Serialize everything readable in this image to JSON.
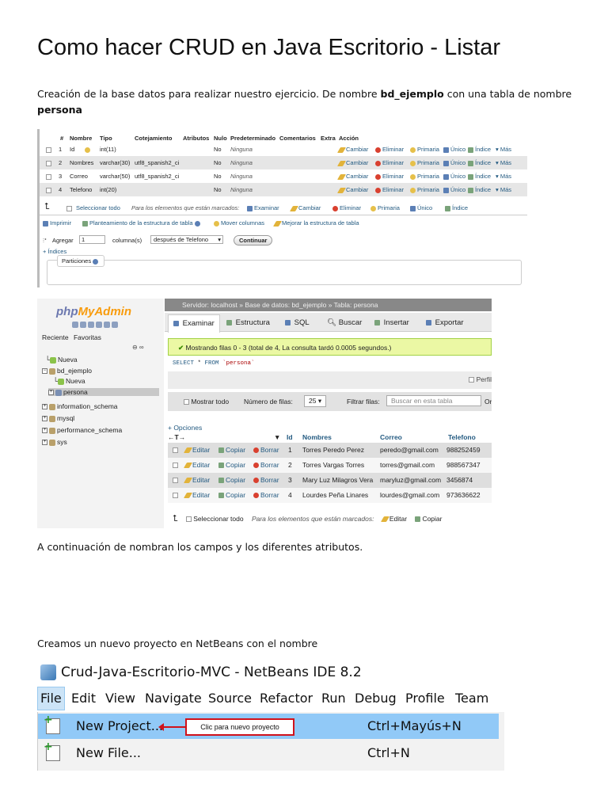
{
  "title": "Como hacer CRUD en Java Escritorio - Listar",
  "intro": {
    "before": "Creación de la base datos para realizar nuestro ejercicio. De nombre ",
    "db_name": "bd_ejemplo",
    "middle": " con una tabla de nombre ",
    "table_name": "persona"
  },
  "structure": {
    "headers": [
      "#",
      "Nombre",
      "Tipo",
      "Cotejamiento",
      "Atributos",
      "Nulo",
      "Predeterminado",
      "Comentarios",
      "Extra",
      "Acción"
    ],
    "rows": [
      {
        "num": "1",
        "name": "Id",
        "type": "int(11)",
        "coll": "",
        "null": "No",
        "default": "Ninguna"
      },
      {
        "num": "2",
        "name": "Nombres",
        "type": "varchar(30)",
        "coll": "utf8_spanish2_ci",
        "null": "No",
        "default": "Ninguna"
      },
      {
        "num": "3",
        "name": "Correo",
        "type": "varchar(50)",
        "coll": "utf8_spanish2_ci",
        "null": "No",
        "default": "Ninguna"
      },
      {
        "num": "4",
        "name": "Telefono",
        "type": "int(20)",
        "coll": "",
        "null": "No",
        "default": "Ninguna"
      }
    ],
    "actions": {
      "change": "Cambiar",
      "delete": "Eliminar",
      "primary": "Primaria",
      "unique": "Único",
      "index": "Índice",
      "more": "Más"
    },
    "select_all": "Seleccionar todo",
    "for_marked": "Para los elementos que están marcados:",
    "bulk": {
      "browse": "Examinar",
      "change": "Cambiar",
      "delete": "Eliminar",
      "primary": "Primaria",
      "unique": "Único",
      "index": "Índice"
    },
    "tools": {
      "print": "Imprimir",
      "plan": "Planteamiento de la estructura de tabla",
      "move": "Mover columnas",
      "improve": "Mejorar la estructura de tabla"
    },
    "add_label": "Agregar",
    "add_value": "1",
    "columns_label": "columna(s)",
    "after_value": "después de Telefono",
    "continue": "Continuar",
    "indexes": "+ Índices",
    "partitions": "Particiones"
  },
  "browse": {
    "logo": {
      "php": "php",
      "my": "My",
      "admin": "Admin"
    },
    "left_tabs": [
      "Reciente",
      "Favoritas"
    ],
    "tree": [
      {
        "label": "Nueva"
      },
      {
        "label": "bd_ejemplo"
      },
      {
        "label": "Nueva"
      },
      {
        "label": "persona"
      },
      {
        "label": "information_schema"
      },
      {
        "label": "mysql"
      },
      {
        "label": "performance_schema"
      },
      {
        "label": "sys"
      }
    ],
    "breadcrumb": "Servidor: localhost » Base de datos: bd_ejemplo » Tabla: persona",
    "tabs": [
      "Examinar",
      "Estructura",
      "SQL",
      "Buscar",
      "Insertar",
      "Exportar"
    ],
    "success": "Mostrando filas 0 - 3 (total de 4, La consulta tardó 0.0005 segundos.)",
    "sql": {
      "kw1": "SELECT",
      "rest": " * ",
      "kw2": "FROM",
      "str": " `persona`"
    },
    "profile": "Perfil",
    "nav": {
      "show_all": "Mostrar todo",
      "rows_label": "Número de filas:",
      "rows_value": "25",
      "filter_label": "Filtrar filas:",
      "filter_placeholder": "Buscar en esta tabla",
      "order": "Or"
    },
    "options": "+ Opciones",
    "columns": [
      "Id",
      "Nombres",
      "Correo",
      "Telefono"
    ],
    "row_actions": {
      "edit": "Editar",
      "copy": "Copiar",
      "delete": "Borrar"
    },
    "rows": [
      {
        "id": "1",
        "name": "Torres Peredo Perez",
        "email": "peredo@gmail.com",
        "phone": "988252459"
      },
      {
        "id": "2",
        "name": "Torres Vargas Torres",
        "email": "torres@gmail.com",
        "phone": "988567347"
      },
      {
        "id": "3",
        "name": "Mary Luz Milagros Vera",
        "email": "maryluz@gmail.com",
        "phone": "3456874"
      },
      {
        "id": "4",
        "name": "Lourdes Peña Linares",
        "email": "lourdes@gmail.com",
        "phone": "973636622"
      }
    ],
    "footer": {
      "select_all": "Seleccionar todo",
      "for_marked": "Para los elementos que están marcados:",
      "edit": "Editar",
      "copy": "Copiar"
    }
  },
  "para2": "A continuación de nombran los campos y los diferentes atributos.",
  "para3": "Creamos un nuevo proyecto en NetBeans con el nombre",
  "netbeans": {
    "window_title": "Crud-Java-Escritorio-MVC - NetBeans IDE 8.2",
    "menus": [
      "File",
      "Edit",
      "View",
      "Navigate",
      "Source",
      "Refactor",
      "Run",
      "Debug",
      "Profile",
      "Team"
    ],
    "items": [
      {
        "label": "New Project...",
        "shortcut": "Ctrl+Mayús+N"
      },
      {
        "label": "New File...",
        "shortcut": "Ctrl+N"
      }
    ],
    "callout": "Clic para nuevo proyecto"
  }
}
